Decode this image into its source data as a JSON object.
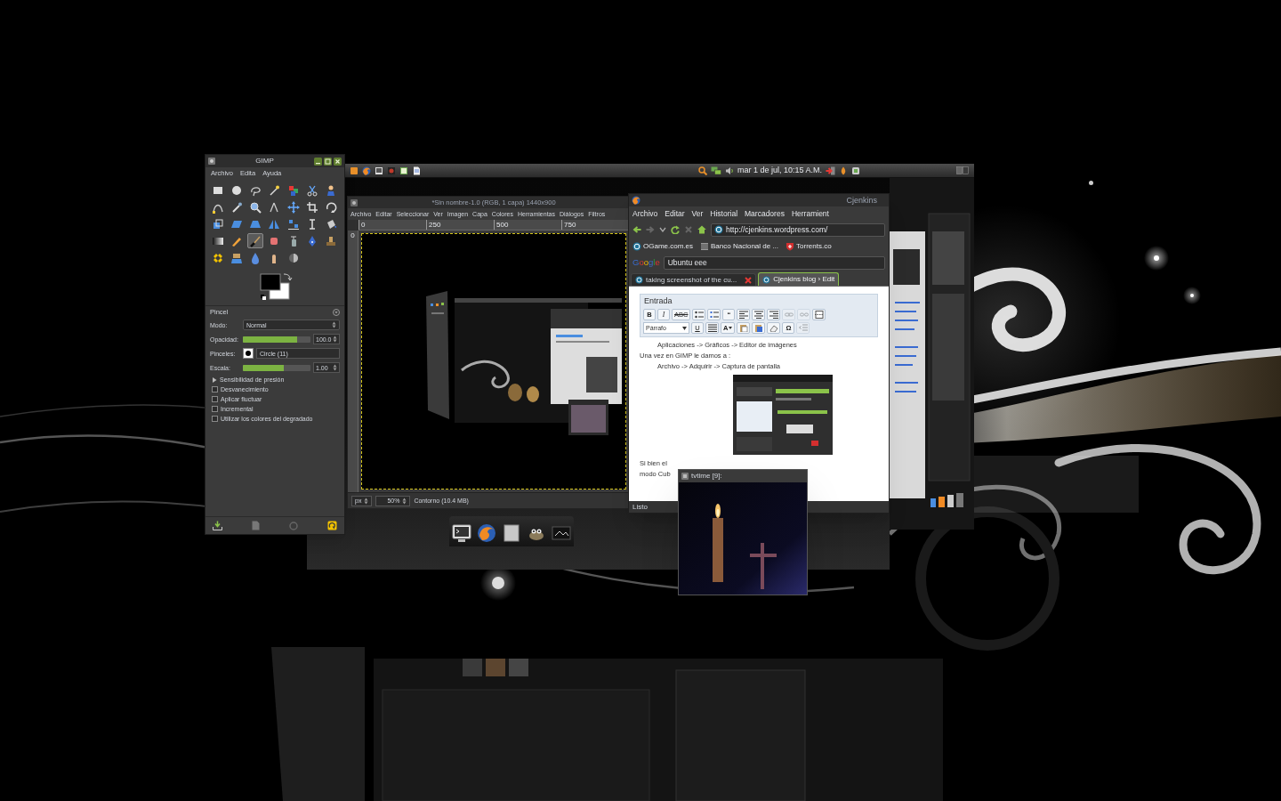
{
  "top_panel": {
    "clock": "mar 1 de jul, 10:15 A.M."
  },
  "gimp_toolbox": {
    "title": "GIMP",
    "menu": [
      "Archivo",
      "Edita",
      "Ayuda"
    ],
    "tools": [
      {
        "kind": "rect",
        "selected": false
      },
      {
        "kind": "ellipse",
        "selected": false
      },
      {
        "kind": "lasso",
        "selected": false
      },
      {
        "kind": "wand",
        "selected": false
      },
      {
        "kind": "colorsel",
        "selected": false
      },
      {
        "kind": "scissors",
        "selected": false
      },
      {
        "kind": "fgselect",
        "selected": false
      },
      {
        "kind": "paths",
        "selected": false
      },
      {
        "kind": "picker",
        "selected": false
      },
      {
        "kind": "zoom",
        "selected": false
      },
      {
        "kind": "measure",
        "selected": false
      },
      {
        "kind": "move",
        "selected": false
      },
      {
        "kind": "crop",
        "selected": false
      },
      {
        "kind": "rotate",
        "selected": false
      },
      {
        "kind": "scale",
        "selected": false
      },
      {
        "kind": "shear",
        "selected": false
      },
      {
        "kind": "perspective",
        "selected": false
      },
      {
        "kind": "flip",
        "selected": false
      },
      {
        "kind": "align",
        "selected": false
      },
      {
        "kind": "text",
        "selected": false
      },
      {
        "kind": "bucket",
        "selected": false
      },
      {
        "kind": "blend",
        "selected": false
      },
      {
        "kind": "pencil",
        "selected": false
      },
      {
        "kind": "brush",
        "selected": true
      },
      {
        "kind": "eraser",
        "selected": false
      },
      {
        "kind": "airbrush",
        "selected": false
      },
      {
        "kind": "ink",
        "selected": false
      },
      {
        "kind": "clone",
        "selected": false
      },
      {
        "kind": "heal",
        "selected": false
      },
      {
        "kind": "pclone",
        "selected": false
      },
      {
        "kind": "blur",
        "selected": false
      },
      {
        "kind": "smudge",
        "selected": false
      },
      {
        "kind": "dodge",
        "selected": false
      }
    ],
    "tool_options": {
      "title": "Pincel",
      "mode": {
        "label": "Modo:",
        "value": "Normal"
      },
      "opacity": {
        "label": "Opacidad:",
        "value": "100.0",
        "level": 0.8
      },
      "brush": {
        "label": "Pinceles:",
        "value": "Circle (11)"
      },
      "scale": {
        "label": "Escala:",
        "value": "1.00",
        "level": 0.6
      },
      "options": [
        {
          "kind": "expander",
          "label": "Sensibilidad de presión",
          "expanded": false
        },
        {
          "kind": "checkbox",
          "label": "Desvanecimiento",
          "checked": false
        },
        {
          "kind": "checkbox",
          "label": "Aplicar fluctuar",
          "checked": false
        },
        {
          "kind": "checkbox",
          "label": "Incremental",
          "checked": false
        },
        {
          "kind": "checkbox",
          "label": "Utilizar los colores del degradado",
          "checked": false
        }
      ]
    }
  },
  "image_window": {
    "title": "*Sin nombre-1.0 (RGB, 1 capa) 1440x900",
    "menu": [
      "Archivo",
      "Editar",
      "Seleccionar",
      "Ver",
      "Imagen",
      "Capa",
      "Colores",
      "Herramientas",
      "Diálogos",
      "Filtros"
    ],
    "ruler_labels": [
      "0",
      "250",
      "500",
      "750"
    ],
    "vertical_ruler_labels": [
      "0"
    ],
    "status": {
      "unit": "px",
      "zoom": "50%",
      "message": "Contorno (10.4 MB)"
    }
  },
  "browser": {
    "title": "Cjenkins",
    "menu": [
      "Archivo",
      "Editar",
      "Ver",
      "Historial",
      "Marcadores",
      "Herramient"
    ],
    "url": "http://cjenkins.wordpress.com/",
    "bookmarks": [
      "OGame.com.es",
      "Banco Nacional de ...",
      "Torrents.co"
    ],
    "search": {
      "engine": "Google",
      "value": "Ubuntu eee"
    },
    "tabs": [
      {
        "label": "taking screenshot of the cu...",
        "selected": false,
        "close_button": true
      },
      {
        "label": "Cjenkins blog › Edit",
        "selected": true,
        "close_button": false
      }
    ],
    "editor": {
      "heading": "Entrada",
      "toolbar": [
        [
          {
            "kind": "bold",
            "label": "B",
            "disabled": false
          },
          {
            "kind": "italic",
            "label": "I",
            "disabled": false
          },
          {
            "kind": "strike",
            "label": "ABC",
            "disabled": false
          },
          {
            "kind": "bullets",
            "disabled": false
          },
          {
            "kind": "numbers",
            "disabled": false
          },
          {
            "kind": "quote",
            "label": "“",
            "disabled": false
          },
          {
            "kind": "alignleft",
            "disabled": false
          },
          {
            "kind": "aligncenter",
            "disabled": false
          },
          {
            "kind": "alignright",
            "disabled": false
          },
          {
            "kind": "link",
            "disabled": true
          },
          {
            "kind": "unlink",
            "disabled": true
          },
          {
            "kind": "more",
            "disabled": false
          }
        ],
        [
          {
            "kind": "select",
            "label": "Párrafo",
            "disabled": false
          },
          {
            "kind": "underline",
            "label": "U",
            "disabled": false
          },
          {
            "kind": "justify",
            "disabled": false
          },
          {
            "kind": "color",
            "label": "A",
            "disabled": false
          },
          {
            "kind": "paste",
            "disabled": false
          },
          {
            "kind": "pasteword",
            "disabled": false
          },
          {
            "kind": "eraser",
            "disabled": false
          },
          {
            "kind": "charmap",
            "label": "Ω",
            "disabled": false
          },
          {
            "kind": "outdent",
            "disabled": true
          }
        ]
      ],
      "paragraphs": [
        {
          "kind": "indented",
          "text": "Aplicaciones -> Gráficos -> Editor de imágenes"
        },
        {
          "kind": "plain",
          "text": "Una vez en GIMP le damos a :"
        },
        {
          "kind": "indented",
          "text": "Archivo -> Adquirir -> Captura de pantalla"
        },
        {
          "kind": "image"
        },
        {
          "kind": "plain",
          "text": "Si bien el"
        },
        {
          "kind": "plain",
          "text": "modo Cub"
        }
      ]
    },
    "status": "Listo"
  },
  "video_window": {
    "title": "tvtime [9]:"
  }
}
